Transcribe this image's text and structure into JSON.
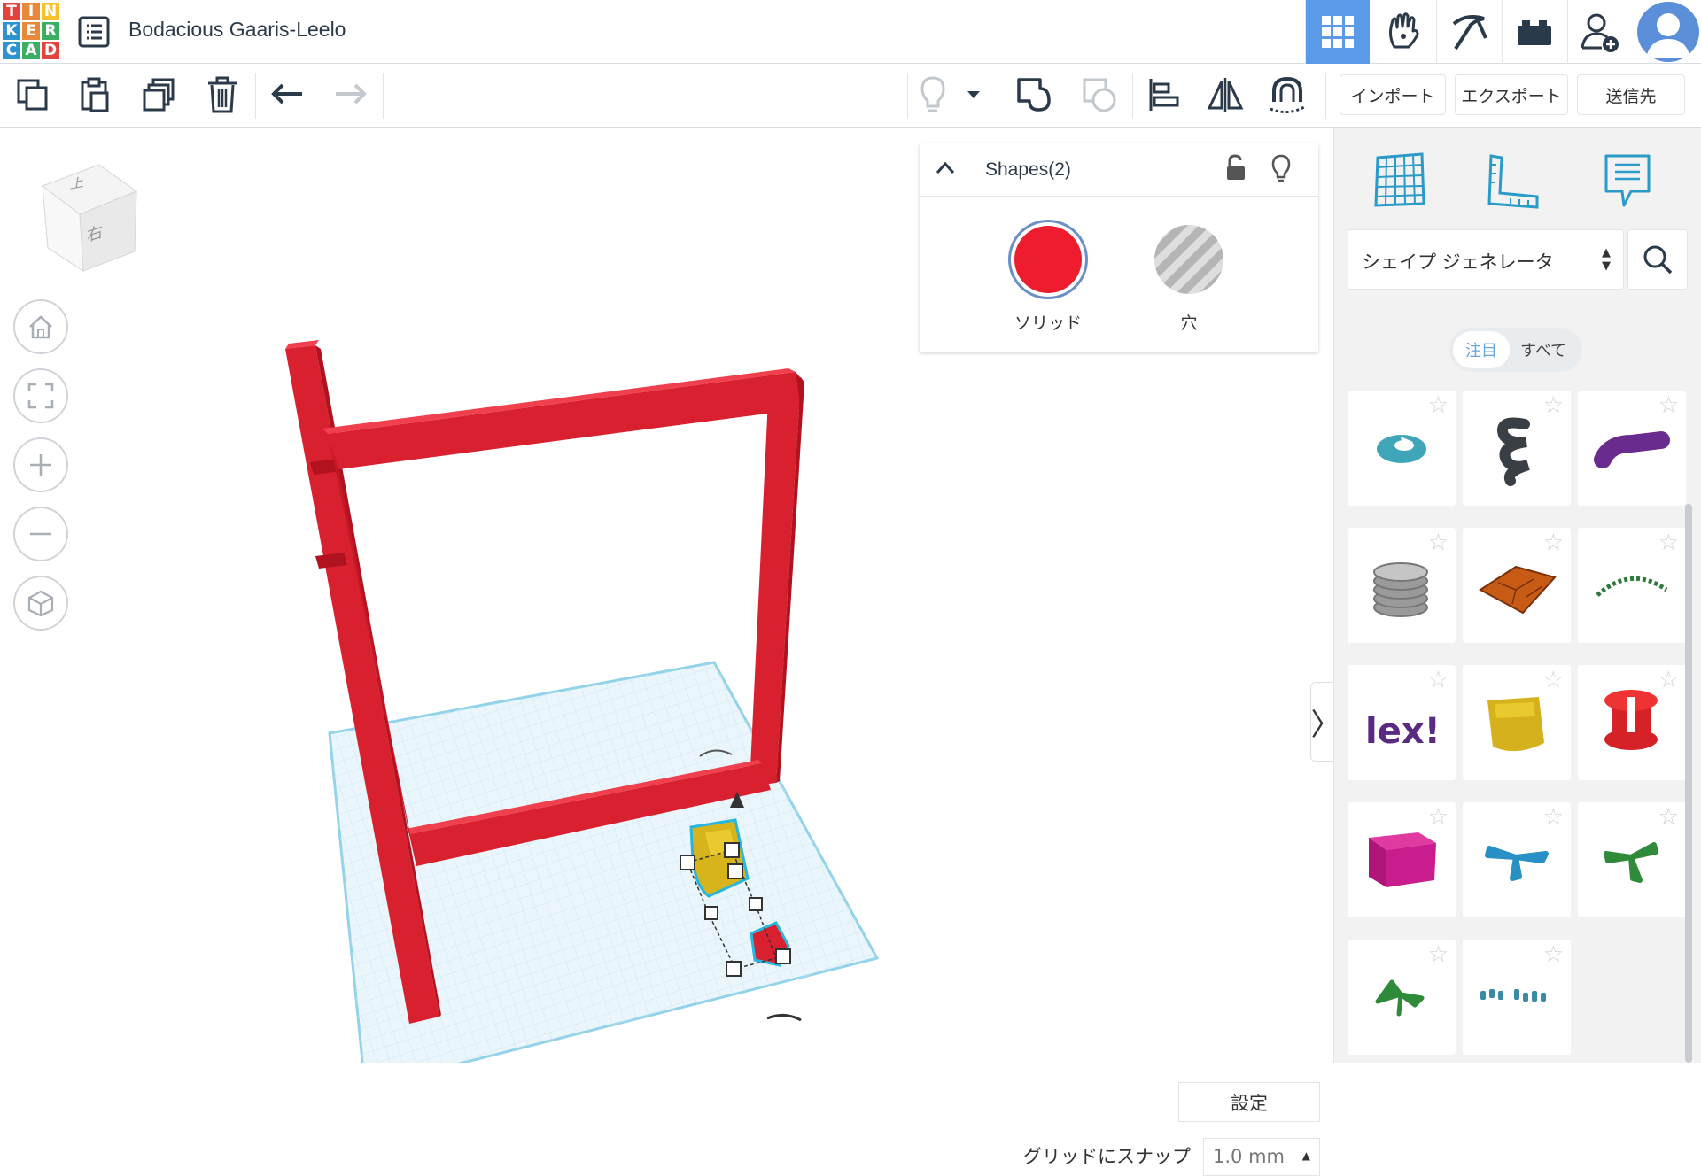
{
  "app": {
    "logo_letters": [
      "T",
      "I",
      "N",
      "K",
      "E",
      "R",
      "C",
      "A",
      "D"
    ],
    "logo_colors": [
      "#e2433d",
      "#e8883a",
      "#f6c32e",
      "#2b93cf",
      "#e8883a",
      "#3cae63",
      "#2b93cf",
      "#3cae63",
      "#e2433d"
    ],
    "title": "Bodacious Gaaris-Leelo"
  },
  "nav": {
    "items": [
      "grid-view-icon",
      "hand-icon",
      "pickaxe-icon",
      "brick-icon",
      "add-user-icon"
    ],
    "active_color": "#5b9ae6"
  },
  "toolbar": {
    "left_icons": [
      "copy-icon",
      "paste-icon",
      "duplicate-icon",
      "delete-icon",
      "undo-icon",
      "redo-icon"
    ],
    "right_icons": [
      "light-bulb-icon",
      "dropdown-arrow-icon",
      "group-shapes-icon",
      "ungroup-icon",
      "align-icon",
      "mirror-icon",
      "cruise-magnet-icon"
    ],
    "import_label": "インポート",
    "export_label": "エクスポート",
    "send_label": "送信先"
  },
  "view_cube": {
    "top_label": "上",
    "side_label": "右"
  },
  "view_controls": [
    "home-icon",
    "fit-view-icon",
    "zoom-in-icon",
    "zoom-out-icon",
    "perspective-cube-icon"
  ],
  "shapes_panel": {
    "title": "Shapes(2)",
    "solid_label": "ソリッド",
    "hole_label": "穴",
    "solid_color": "#ed1c2e"
  },
  "workplane": {
    "settings_label": "設定",
    "snap_label": "グリッドにスナップ",
    "snap_value": "1.0 mm"
  },
  "right_panel": {
    "top_icons": [
      "workplane-icon",
      "ruler-icon",
      "notes-icon"
    ],
    "generator_select": "シェイプ ジェネレータ",
    "filter_featured": "注目",
    "filter_all": "すべて",
    "shape_tiles": [
      {
        "name": "torus-shape",
        "color": "#3ea6b8"
      },
      {
        "name": "spring-shape",
        "color": "#3a3f45"
      },
      {
        "name": "curved-pipe-shape",
        "color": "#6a2b8f"
      },
      {
        "name": "stacked-coins-shape",
        "color": "#9a9a9a"
      },
      {
        "name": "voronoi-tile-shape",
        "color": "#c75b16"
      },
      {
        "name": "chain-arc-shape",
        "color": "#2f7a3a"
      },
      {
        "name": "text-shape",
        "color": "#5a2a82"
      },
      {
        "name": "square-cup-shape",
        "color": "#d4b11d"
      },
      {
        "name": "spool-shape",
        "color": "#d42226"
      },
      {
        "name": "box-shape",
        "color": "#b0157a"
      },
      {
        "name": "propeller-blue-shape",
        "color": "#2890c4"
      },
      {
        "name": "propeller-green-shape",
        "color": "#2f8a3a"
      },
      {
        "name": "leaf-shape",
        "color": "#2f8a3a"
      },
      {
        "name": "dots-shape",
        "color": "#3a8aa5"
      }
    ]
  }
}
